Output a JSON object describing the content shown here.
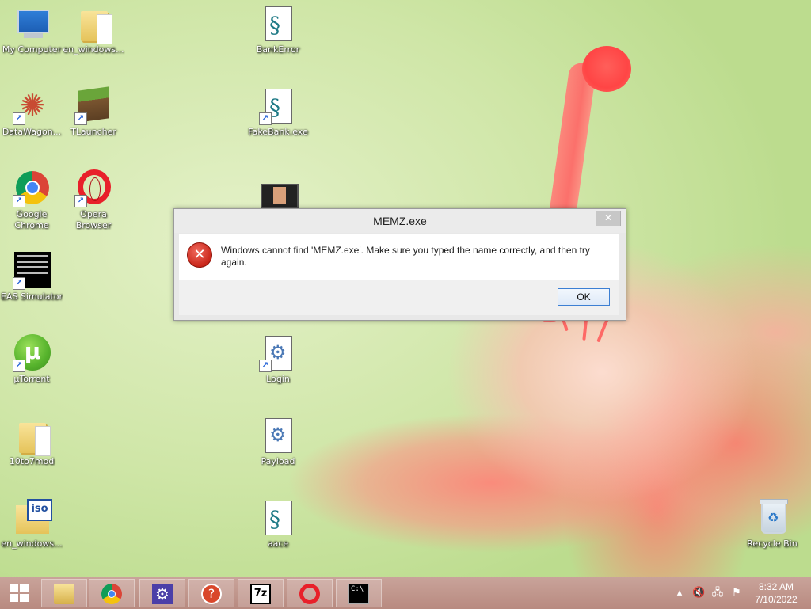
{
  "desktop": {
    "icons": [
      {
        "label": "My Computer",
        "icon": "computer-icon"
      },
      {
        "label": "en_windows...",
        "icon": "folder-icon"
      },
      {
        "label": "BankError",
        "icon": "script-file-icon"
      },
      {
        "label": "DataWagon...",
        "icon": "datawagon-icon"
      },
      {
        "label": "TLauncher",
        "icon": "minecraft-icon"
      },
      {
        "label": "FakeBank.exe",
        "icon": "script-file-icon"
      },
      {
        "label": "Google Chrome",
        "icon": "chrome-icon"
      },
      {
        "label": "Opera Browser",
        "icon": "opera-icon"
      },
      {
        "label": "EAS Simulator",
        "icon": "eas-simulator-icon"
      },
      {
        "label": "µTorrent",
        "icon": "utorrent-icon"
      },
      {
        "label": "Login",
        "icon": "gear-file-icon"
      },
      {
        "label": "10to7mod",
        "icon": "folder-icon"
      },
      {
        "label": "Payload",
        "icon": "gear-file-icon"
      },
      {
        "label": "en_windows...",
        "icon": "iso-folder-icon"
      },
      {
        "label": "aace",
        "icon": "script-file-icon"
      },
      {
        "label": "Recycle Bin",
        "icon": "recycle-bin-icon"
      }
    ]
  },
  "dialog": {
    "title": "MEMZ.exe",
    "message": "Windows cannot find 'MEMZ.exe'. Make sure you typed the name correctly, and then try again.",
    "ok_label": "OK",
    "close_glyph": "✕",
    "error_glyph": "✕"
  },
  "taskbar": {
    "apps": [
      {
        "name": "file-explorer"
      },
      {
        "name": "chrome"
      },
      {
        "name": "settings"
      },
      {
        "name": "help"
      },
      {
        "name": "7zip",
        "text": "7z"
      },
      {
        "name": "opera"
      },
      {
        "name": "command-prompt",
        "text": "C:\\_"
      }
    ],
    "clock": {
      "time": "8:32 AM",
      "date": "7/10/2022"
    }
  }
}
